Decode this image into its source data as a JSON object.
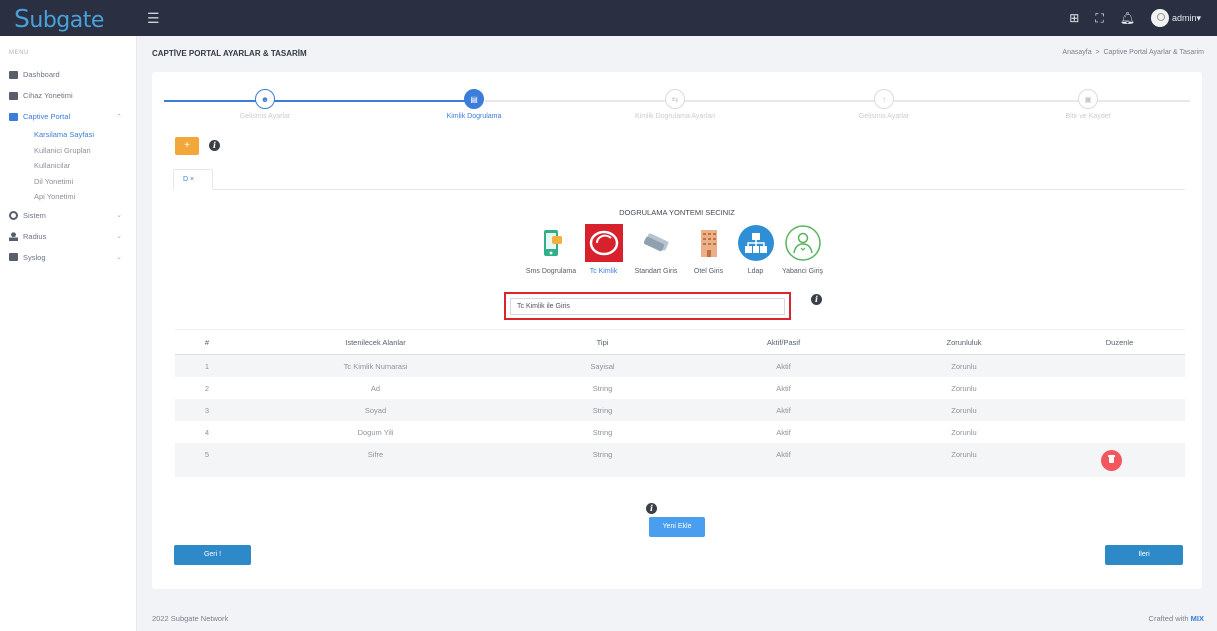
{
  "app": {
    "logo_first": "S",
    "logo_rest": "ubgate"
  },
  "topbar": {
    "user": "admin"
  },
  "sidebar": {
    "menu_title": "MENU",
    "items": [
      {
        "label": "Dashboard"
      },
      {
        "label": "Cihaz Yonetimi"
      },
      {
        "label": "Captive Portal"
      },
      {
        "label": "Sistem"
      },
      {
        "label": "Radius"
      },
      {
        "label": "Syslog"
      }
    ],
    "sub_items": [
      {
        "label": "Karsilama Sayfasi"
      },
      {
        "label": "Kullanici Gruplari"
      },
      {
        "label": "Kullanicilar"
      },
      {
        "label": "Dil Yonetimi"
      },
      {
        "label": "Api Yonetimi"
      }
    ]
  },
  "page": {
    "title": "CAPTİVE PORTAL AYARLAR & TASARİM",
    "breadcrumb_home": "Anasayfa",
    "breadcrumb_sep": ">",
    "breadcrumb_current": "Captive Portal Ayarlar & Tasarim"
  },
  "stepper": {
    "steps": [
      {
        "label": "Gelismis Ayarlar"
      },
      {
        "label": "Kimlik Dogrulama"
      },
      {
        "label": "Kimlik Dogrulama Ayarlari"
      },
      {
        "label": "Gelismis Ayarlar"
      },
      {
        "label": "Bitir ve Kaydet"
      }
    ]
  },
  "toolbar": {
    "add_label": "+"
  },
  "tabs": [
    {
      "label": "D ×"
    }
  ],
  "auth": {
    "title": "DOGRULAMA YONTEMI SECINIZ",
    "methods": [
      {
        "label": "Sms Dogrulama"
      },
      {
        "label": "Tc Kimlik"
      },
      {
        "label": "Standart Giris"
      },
      {
        "label": "Otel Giris"
      },
      {
        "label": "Ldap"
      },
      {
        "label": "Yabanci Giriş"
      }
    ],
    "selected_value": "Tc Kimlik ile Giris"
  },
  "table": {
    "headers": [
      "#",
      "Istenilecek Alanlar",
      "Tipi",
      "Aktif/Pasif",
      "Zorunluluk",
      "Duzenle"
    ],
    "rows": [
      [
        "1",
        "Tc Kimlik Numarasi",
        "Sayisal",
        "Aktif",
        "Zorunlu"
      ],
      [
        "2",
        "Ad",
        "String",
        "Aktif",
        "Zorunlu"
      ],
      [
        "3",
        "Soyad",
        "String",
        "Aktif",
        "Zorunlu"
      ],
      [
        "4",
        "Dogum Yili",
        "String",
        "Aktif",
        "Zorunlu"
      ],
      [
        "5",
        "Sifre",
        "String",
        "Aktif",
        "Zorunlu"
      ]
    ]
  },
  "actions": {
    "new_label": "Yeni Ekle",
    "back_label": "Geri !",
    "next_label": "Ileri"
  },
  "footer": {
    "left": "2022 Subgate Network",
    "right_prefix": "Crafted with",
    "right_brand": "MIX"
  },
  "colors": {
    "topbar": "#2a3042",
    "accent": "#3c7dd9",
    "highlight": "#d9262c",
    "add": "#f1a73a",
    "delete": "#f2575e"
  }
}
